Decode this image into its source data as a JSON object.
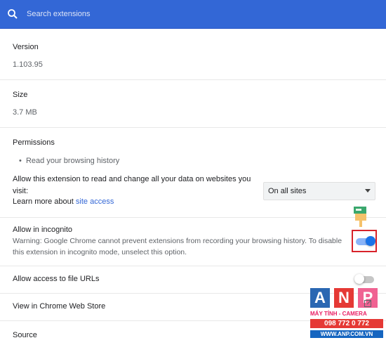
{
  "search": {
    "placeholder": "Search extensions"
  },
  "version": {
    "label": "Version",
    "value": "1.103.95"
  },
  "size": {
    "label": "Size",
    "value": "3.7 MB"
  },
  "permissions": {
    "label": "Permissions",
    "items": [
      "Read your browsing history"
    ],
    "access_text_line1": "Allow this extension to read and change all your data on websites you",
    "access_text_line2": "visit:",
    "learn_more_prefix": "Learn more about",
    "learn_more_link": "site access",
    "site_access_selected": "On all sites"
  },
  "incognito": {
    "label": "Allow in incognito",
    "warning_line1": "Warning: Google Chrome cannot prevent extensions from recording your browsing history. To disable",
    "warning_line2": "this extension in incognito mode, unselect this option.",
    "enabled": true
  },
  "file_urls": {
    "label": "Allow access to file URLs",
    "enabled": false
  },
  "web_store": {
    "label": "View in Chrome Web Store",
    "icon": "open-in-new-icon"
  },
  "source": {
    "label": "Source"
  },
  "watermark": {
    "letters": [
      "A",
      "N",
      "P"
    ],
    "letter_colors": [
      "#2a67b2",
      "#e53935",
      "#f06292"
    ],
    "subtitle": "MÁY TÍNH - CAMERA",
    "phone": "098 772 0 772",
    "url": "WWW.ANP.COM.VN"
  },
  "colors": {
    "accent": "#3367d6",
    "toggle_on": "#1a73e8",
    "highlight": "#d8232a"
  }
}
